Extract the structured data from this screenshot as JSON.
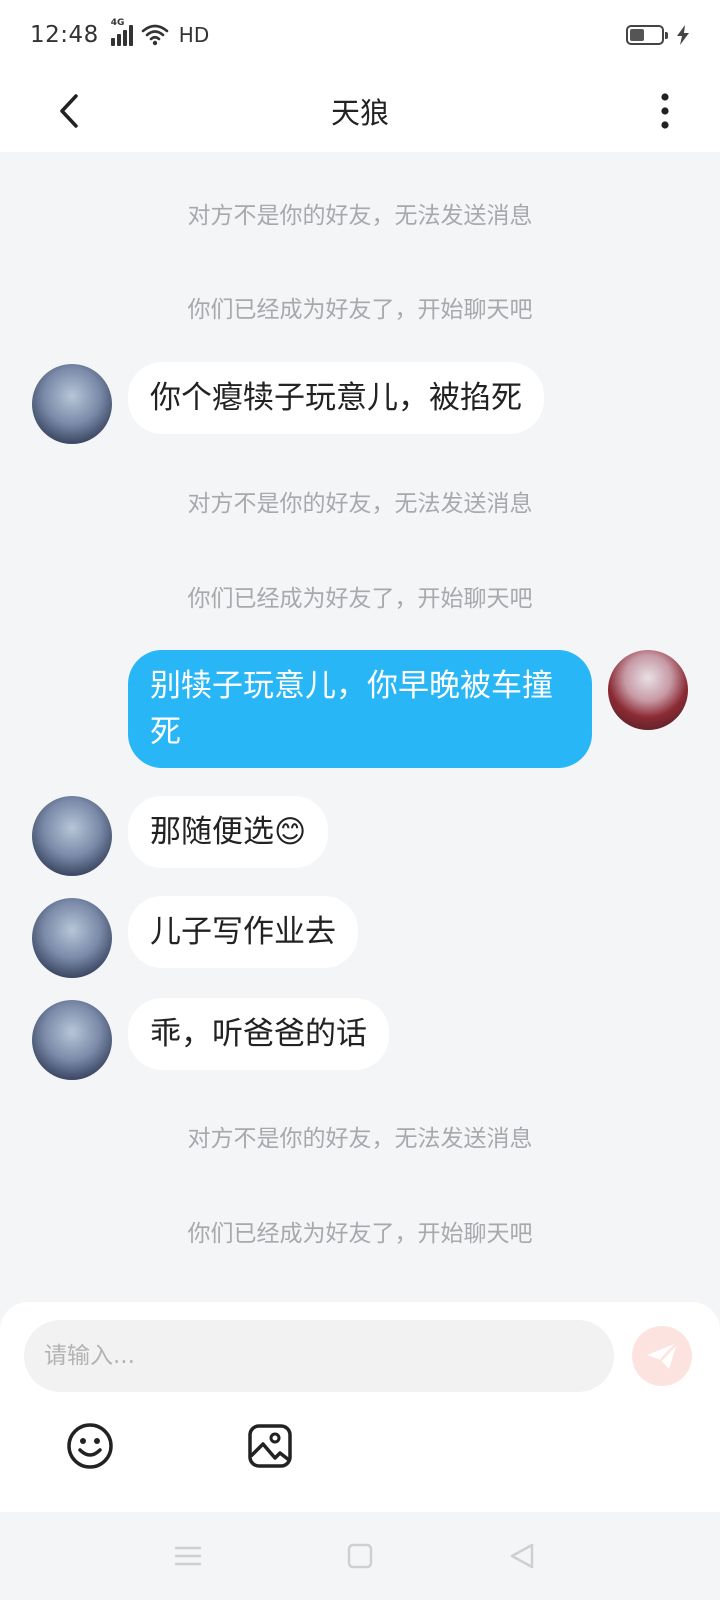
{
  "status_bar": {
    "time": "12:48",
    "network": "4G",
    "hd": "HD",
    "icons": [
      "signal-icon",
      "wifi-icon",
      "battery-icon",
      "charging-icon"
    ]
  },
  "header": {
    "title": "天狼",
    "back_icon": "chevron-left-icon",
    "more_icon": "more-vertical-icon"
  },
  "messages": [
    {
      "type": "system",
      "text": "对方不是你的好友，无法发送消息"
    },
    {
      "type": "system",
      "text": "你们已经成为好友了，开始聊天吧"
    },
    {
      "type": "received",
      "text": "你个瘪犊子玩意儿，被掐死"
    },
    {
      "type": "system",
      "text": "对方不是你的好友，无法发送消息"
    },
    {
      "type": "system",
      "text": "你们已经成为好友了，开始聊天吧"
    },
    {
      "type": "sent",
      "text": "别犊子玩意儿，你早晚被车撞死"
    },
    {
      "type": "received",
      "text": "那随便选😊"
    },
    {
      "type": "received",
      "text": "儿子写作业去"
    },
    {
      "type": "received",
      "text": "乖，听爸爸的话"
    },
    {
      "type": "system",
      "text": "对方不是你的好友，无法发送消息"
    },
    {
      "type": "system",
      "text": "你们已经成为好友了，开始聊天吧"
    }
  ],
  "input": {
    "placeholder": "请输入...",
    "value": "",
    "send_icon": "send-icon",
    "tools": [
      "emoji-icon",
      "image-icon"
    ]
  },
  "nav": {
    "icons": [
      "menu-icon",
      "home-icon",
      "back-icon"
    ]
  },
  "colors": {
    "sent_bubble": "#29b6f6",
    "received_bubble": "#ffffff",
    "background": "#f4f5f7",
    "system_text": "#a8a8ad",
    "send_button": "#fde3e0"
  }
}
